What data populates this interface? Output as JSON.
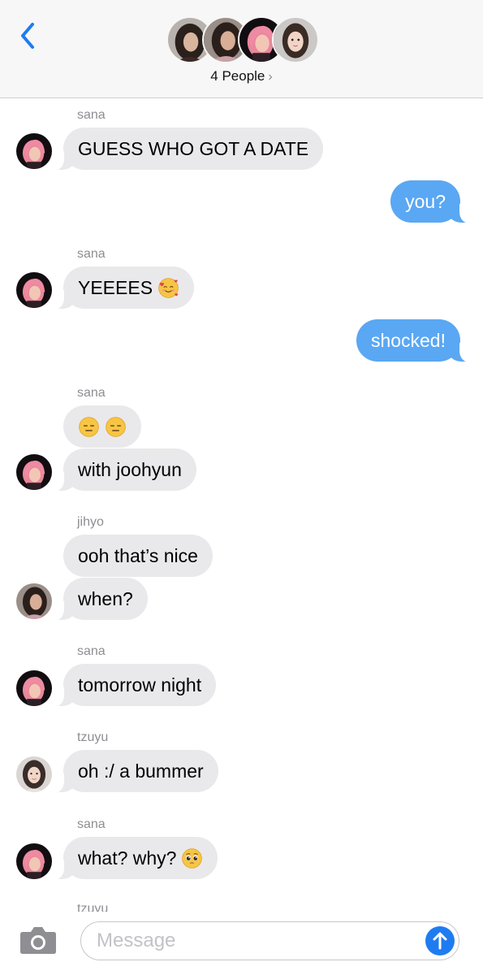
{
  "header": {
    "back_icon": "chevron-left-icon",
    "people_label": "4 People",
    "people_chevron": "›",
    "avatars": [
      "jihyo-avatar",
      "tzuyu-avatar",
      "sana-avatar",
      "member-avatar"
    ]
  },
  "messages": [
    {
      "sender": "sana",
      "side": "in",
      "text": "GUESS WHO GOT A DATE"
    },
    {
      "sender": "",
      "side": "out",
      "text": "you?"
    },
    {
      "sender": "sana",
      "side": "in",
      "text": "YEEEES",
      "emoji": "smiling-face-with-hearts"
    },
    {
      "sender": "",
      "side": "out",
      "text": "shocked!"
    },
    {
      "sender": "sana",
      "side": "in",
      "text": "",
      "emoji": "expressionless-face x2"
    },
    {
      "sender": "sana",
      "side": "in",
      "text": "with joohyun"
    },
    {
      "sender": "jihyo",
      "side": "in",
      "text": "ooh that’s nice"
    },
    {
      "sender": "jihyo",
      "side": "in",
      "text": "when?"
    },
    {
      "sender": "sana",
      "side": "in",
      "text": "tomorrow night"
    },
    {
      "sender": "tzuyu",
      "side": "in",
      "text": "oh :/ a bummer"
    },
    {
      "sender": "sana",
      "side": "in",
      "text": "what? why?",
      "emoji": "pleading-face"
    }
  ],
  "partial_sender": "tzuyu",
  "composer": {
    "camera_icon": "camera-icon",
    "placeholder": "Message",
    "send_icon": "arrow-up-icon"
  },
  "colors": {
    "incoming_bubble": "#e9e9eb",
    "outgoing_bubble": "#5aa7f3",
    "accent": "#1f7cf0"
  }
}
